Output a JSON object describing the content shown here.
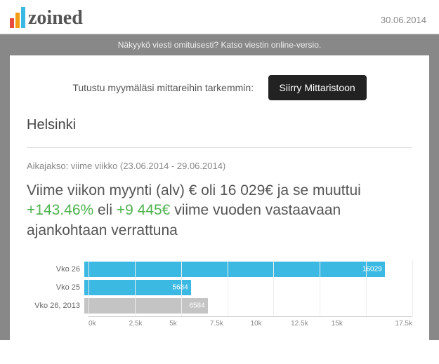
{
  "header": {
    "brand": "zoined",
    "date": "30.06.2014"
  },
  "notice": "Näkyykö viesti omituisesti? Katso viestin online-versio.",
  "cta": {
    "text": "Tutustu myymäläsi mittareihin tarkemmin:",
    "button": "Siirry Mittaristoon"
  },
  "city": "Helsinki",
  "period": "Aikajakso: viime viikko (23.06.2014 - 29.06.2014)",
  "summary": {
    "p1": "Viime viikon myynti (alv) € oli 16 029€ ja se muuttui ",
    "pct": "+143.46%",
    "mid": " eli ",
    "delta": "+9 445€",
    "p2": " viime vuoden vastaavaan ajankohtaan verrattuna"
  },
  "chart_data": {
    "type": "bar",
    "categories": [
      "Vko 26",
      "Vko 25",
      "Vko 26, 2013"
    ],
    "values": [
      16029,
      5684,
      6584
    ],
    "colors": [
      "#3bb9e3",
      "#3bb9e3",
      "#c4c4c4"
    ],
    "xlim": [
      0,
      17500
    ],
    "ticks": [
      "0k",
      "2.5k",
      "5k",
      "7.5k",
      "10k",
      "12.5k",
      "15k",
      "17.5k"
    ]
  }
}
